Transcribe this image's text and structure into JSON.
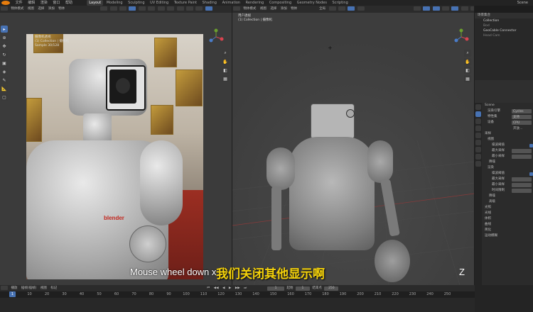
{
  "menubar": {
    "file": "文件",
    "edit": "编辑",
    "render": "渲染",
    "window": "窗口",
    "help": "帮助",
    "workspaces": [
      "Layout",
      "Modeling",
      "Sculpting",
      "UV Editing",
      "Texture Paint",
      "Shading",
      "Animation",
      "Rendering",
      "Compositing",
      "Geometry Nodes",
      "Scripting"
    ],
    "active_workspace": "Layout",
    "scene_label": "Scene"
  },
  "left_viewport": {
    "mode": "物体模式",
    "view": "视图",
    "select": "选择",
    "add": "添加",
    "object": "物体",
    "overlay_title": "摄像机透视",
    "overlay_collection": "(1) Collection | 摄像机",
    "overlay_samples": "Sample 30/128",
    "render_caption": "blender"
  },
  "right_viewport": {
    "shading": "全局",
    "overlay_title": "用户透视",
    "overlay_collection": "(1) Collection | 摄像机"
  },
  "outliner": {
    "title": "场景集合",
    "items": [
      "Collection",
      "Bod",
      "GeoCable Connector",
      "Head Cam"
    ]
  },
  "properties": {
    "scene": "Scene",
    "rows": [
      {
        "label": "渲染引擎",
        "value": "Cycles"
      },
      {
        "label": "特性集",
        "value": "支持"
      },
      {
        "label": "设备",
        "value": "CPU"
      },
      {
        "label": "",
        "value": "开放..."
      }
    ],
    "sections": [
      "采样",
      "视图",
      "渲染",
      "降噪",
      "采样",
      "视图",
      "渲染",
      "高级",
      "光照",
      "光线",
      "体积",
      "体积",
      "曲线",
      "简化",
      "运动模糊"
    ],
    "sub_rows": [
      {
        "label": "噪波阈值",
        "value": ""
      },
      {
        "label": "最大采样",
        "value": ""
      },
      {
        "label": "最小采样",
        "value": ""
      },
      {
        "label": "噪波阈值",
        "value": ""
      },
      {
        "label": "最大采样",
        "value": ""
      },
      {
        "label": "最小采样",
        "value": ""
      },
      {
        "label": "时间限制",
        "value": ""
      }
    ]
  },
  "timeline": {
    "playback": "播放",
    "keying": "插帧(插帧)",
    "view": "视图",
    "marker": "标记",
    "current_frame": "1",
    "start_label": "起始",
    "start": "1",
    "end_label": "结束点",
    "end": "250",
    "ticks": [
      "0",
      "10",
      "20",
      "30",
      "40",
      "50",
      "60",
      "70",
      "80",
      "90",
      "100",
      "110",
      "120",
      "130",
      "140",
      "150",
      "160",
      "170",
      "180",
      "190",
      "200",
      "210",
      "220",
      "230",
      "240",
      "250"
    ]
  },
  "captions": {
    "en": "Mouse wheel down x",
    "zh": "我们关闭其他显示啊",
    "key": "Z"
  },
  "colors": {
    "accent": "#4772b3",
    "caption_zh": "#f5d20a",
    "blender_logo": "#e87d0d"
  }
}
